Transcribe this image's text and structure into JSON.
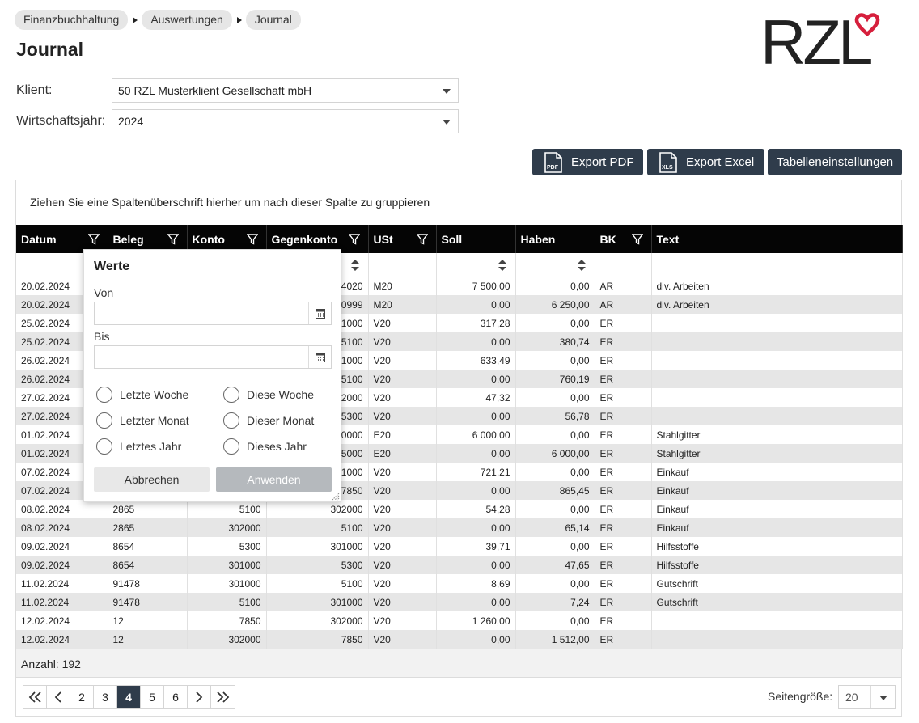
{
  "breadcrumb": [
    "Finanzbuchhaltung",
    "Auswertungen",
    "Journal"
  ],
  "page_title": "Journal",
  "logo_text": "RZL",
  "form": {
    "client_label": "Klient:",
    "client_value": "50 RZL Musterklient Gesellschaft mbH",
    "year_label": "Wirtschaftsjahr:",
    "year_value": "2024"
  },
  "toolbar": {
    "export_pdf": "Export PDF",
    "pdf_icon_text": "PDF",
    "export_excel": "Export Excel",
    "xls_icon_text": "XLS",
    "table_settings": "Tabelleneinstellungen"
  },
  "grid": {
    "group_hint": "Ziehen Sie eine Spaltenüberschrift hierher um nach dieser Spalte zu gruppieren",
    "columns": [
      "Datum",
      "Beleg",
      "Konto",
      "Gegenkonto",
      "USt",
      "Soll",
      "Haben",
      "BK",
      "Text"
    ],
    "rows": [
      [
        "20.02.2024",
        "",
        "",
        "4020",
        "M20",
        "7 500,00",
        "0,00",
        "AR",
        "div. Arbeiten"
      ],
      [
        "20.02.2024",
        "",
        "",
        "0999",
        "M20",
        "0,00",
        "6 250,00",
        "AR",
        "div. Arbeiten"
      ],
      [
        "25.02.2024",
        "",
        "",
        "1000",
        "V20",
        "317,28",
        "0,00",
        "ER",
        ""
      ],
      [
        "25.02.2024",
        "",
        "",
        "5100",
        "V20",
        "0,00",
        "380,74",
        "ER",
        ""
      ],
      [
        "26.02.2024",
        "",
        "",
        "1000",
        "V20",
        "633,49",
        "0,00",
        "ER",
        ""
      ],
      [
        "26.02.2024",
        "",
        "",
        "5100",
        "V20",
        "0,00",
        "760,19",
        "ER",
        ""
      ],
      [
        "27.02.2024",
        "",
        "",
        "2000",
        "V20",
        "47,32",
        "0,00",
        "ER",
        ""
      ],
      [
        "27.02.2024",
        "",
        "",
        "5300",
        "V20",
        "0,00",
        "56,78",
        "ER",
        ""
      ],
      [
        "01.02.2024",
        "",
        "",
        "0000",
        "E20",
        "6 000,00",
        "0,00",
        "ER",
        "Stahlgitter"
      ],
      [
        "01.02.2024",
        "",
        "",
        "5000",
        "E20",
        "0,00",
        "6 000,00",
        "ER",
        "Stahlgitter"
      ],
      [
        "07.02.2024",
        "",
        "",
        "1000",
        "V20",
        "721,21",
        "0,00",
        "ER",
        "Einkauf"
      ],
      [
        "07.02.2024",
        "",
        "",
        "7850",
        "V20",
        "0,00",
        "865,45",
        "ER",
        "Einkauf"
      ],
      [
        "08.02.2024",
        "2865",
        "5100",
        "302000",
        "V20",
        "54,28",
        "0,00",
        "ER",
        "Einkauf"
      ],
      [
        "08.02.2024",
        "2865",
        "302000",
        "5100",
        "V20",
        "0,00",
        "65,14",
        "ER",
        "Einkauf"
      ],
      [
        "09.02.2024",
        "8654",
        "5300",
        "301000",
        "V20",
        "39,71",
        "0,00",
        "ER",
        "Hilfsstoffe"
      ],
      [
        "09.02.2024",
        "8654",
        "301000",
        "5300",
        "V20",
        "0,00",
        "47,65",
        "ER",
        "Hilfsstoffe"
      ],
      [
        "11.02.2024",
        "91478",
        "301000",
        "5100",
        "V20",
        "8,69",
        "0,00",
        "ER",
        "Gutschrift"
      ],
      [
        "11.02.2024",
        "91478",
        "5100",
        "301000",
        "V20",
        "0,00",
        "7,24",
        "ER",
        "Gutschrift"
      ],
      [
        "12.02.2024",
        "12",
        "7850",
        "302000",
        "V20",
        "1 260,00",
        "0,00",
        "ER",
        ""
      ],
      [
        "12.02.2024",
        "12",
        "302000",
        "7850",
        "V20",
        "0,00",
        "1 512,00",
        "ER",
        ""
      ]
    ],
    "count_label": "Anzahl: 192"
  },
  "pager": {
    "pages": [
      "2",
      "3",
      "4",
      "5",
      "6"
    ],
    "active": "4",
    "pagesize_label": "Seitengröße:",
    "pagesize_value": "20"
  },
  "filter_popup": {
    "title": "Werte",
    "from_label": "Von",
    "to_label": "Bis",
    "options": [
      "Letzte Woche",
      "Diese Woche",
      "Letzter Monat",
      "Dieser Monat",
      "Letztes Jahr",
      "Dieses Jahr"
    ],
    "cancel": "Abbrechen",
    "apply": "Anwenden"
  },
  "colors": {
    "header_bg": "#050505",
    "button_bg": "#2f3c4b",
    "logo_heart": "#d61f3c",
    "row_stripe": "#e6e6e6"
  }
}
